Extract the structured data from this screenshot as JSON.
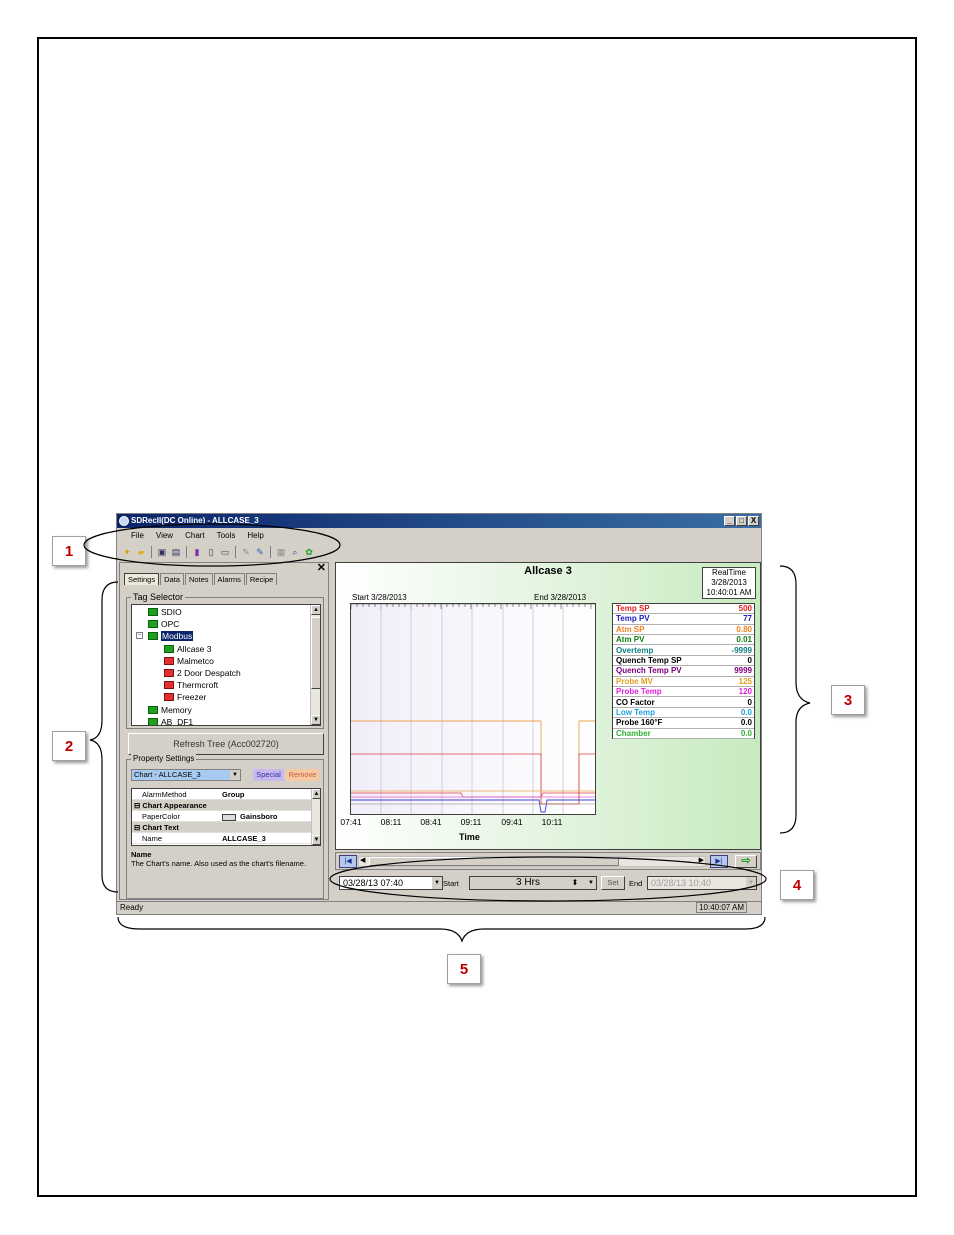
{
  "window": {
    "title": "SDRecII(DC Online) - ALLCASE_3",
    "buttons": [
      "_",
      "□",
      "X"
    ]
  },
  "menu": [
    "File",
    "View",
    "Chart",
    "Tools",
    "Help"
  ],
  "toolbar_icons": [
    "new-icon",
    "open-icon",
    "save-icon",
    "save-as-icon",
    "report-icon",
    "print-preview-icon",
    "print-icon",
    "connect-icon",
    "disconnect-icon",
    "list-icon",
    "find-icon",
    "refresh-icon"
  ],
  "left_pane": {
    "tabs": [
      "Settings",
      "Data",
      "Notes",
      "Alarms",
      "Recipe"
    ],
    "active_tab": "Settings",
    "tag_selector_title": "Tag Selector",
    "tree": [
      {
        "label": "SDIO",
        "level": 0,
        "icon": "green"
      },
      {
        "label": "OPC",
        "level": 0,
        "icon": "green"
      },
      {
        "label": "Modbus",
        "level": 0,
        "icon": "green",
        "selected": true,
        "expanded": true
      },
      {
        "label": "Allcase 3",
        "level": 1,
        "icon": "green"
      },
      {
        "label": "Malmetco",
        "level": 1,
        "icon": "red"
      },
      {
        "label": "2 Door Despatch",
        "level": 1,
        "icon": "red"
      },
      {
        "label": "Thermcroft",
        "level": 1,
        "icon": "red"
      },
      {
        "label": "Freezer",
        "level": 1,
        "icon": "red"
      },
      {
        "label": "Memory",
        "level": 0,
        "icon": "green"
      },
      {
        "label": "AB_DF1",
        "level": 0,
        "icon": "green"
      }
    ],
    "refresh_button": "Refresh Tree (Acc002720)",
    "property_settings_title": "Property Settings",
    "property_combo": "Chart - ALLCASE_3",
    "special_button": "Special",
    "remove_button": "Remove",
    "properties": {
      "alarm_method": {
        "key": "AlarmMethod",
        "value": "Group"
      },
      "cat_appearance": "Chart Appearance",
      "paper_color": {
        "key": "PaperColor",
        "value": "Gainsboro"
      },
      "cat_text": "Chart Text",
      "name": {
        "key": "Name",
        "value": "ALLCASE_3"
      }
    },
    "description_title": "Name",
    "description_text": "The Chart's name. Also used as the chart's filename."
  },
  "chart": {
    "title": "Allcase 3",
    "realtime_label": "RealTime",
    "realtime_date": "3/28/2013",
    "realtime_time": "10:40:01 AM",
    "start_label": "Start 3/28/2013",
    "end_label": "End 3/28/2013",
    "x_axis_title": "Time",
    "x_ticks": [
      "07:41",
      "08:11",
      "08:41",
      "09:11",
      "09:41",
      "10:11"
    ],
    "legend": [
      {
        "name": "Temp SP",
        "value": "500",
        "color": "#e02020"
      },
      {
        "name": "Temp PV",
        "value": "77",
        "color": "#2020c0"
      },
      {
        "name": "Atm SP",
        "value": "0.80",
        "color": "#f08020"
      },
      {
        "name": "Atm PV",
        "value": "0.01",
        "color": "#108010"
      },
      {
        "name": "Overtemp",
        "value": "-9999",
        "color": "#108080"
      },
      {
        "name": "Quench Temp SP",
        "value": "0",
        "color": "#000000"
      },
      {
        "name": "Quench Temp PV",
        "value": "9999",
        "color": "#800080"
      },
      {
        "name": "Probe MV",
        "value": "125",
        "color": "#e0a020"
      },
      {
        "name": "Probe Temp",
        "value": "120",
        "color": "#e020e0"
      },
      {
        "name": "CO Factor",
        "value": "0",
        "color": "#000000"
      },
      {
        "name": "Low Temp",
        "value": "0.0",
        "color": "#20a0e0"
      },
      {
        "name": "Probe 160°F",
        "value": "0.0",
        "color": "#000000"
      },
      {
        "name": "Chamber",
        "value": "0.0",
        "color": "#30b030"
      }
    ]
  },
  "range": {
    "start_value": "03/28/13  07:40",
    "start_label": "Start",
    "span_value": "3 Hrs",
    "set_button": "Set",
    "end_label": "End",
    "end_value": "03/28/13  10:40"
  },
  "status": {
    "text": "Ready",
    "time": "10:40:07 AM"
  },
  "callouts": [
    "1",
    "2",
    "3",
    "4",
    "5"
  ]
}
